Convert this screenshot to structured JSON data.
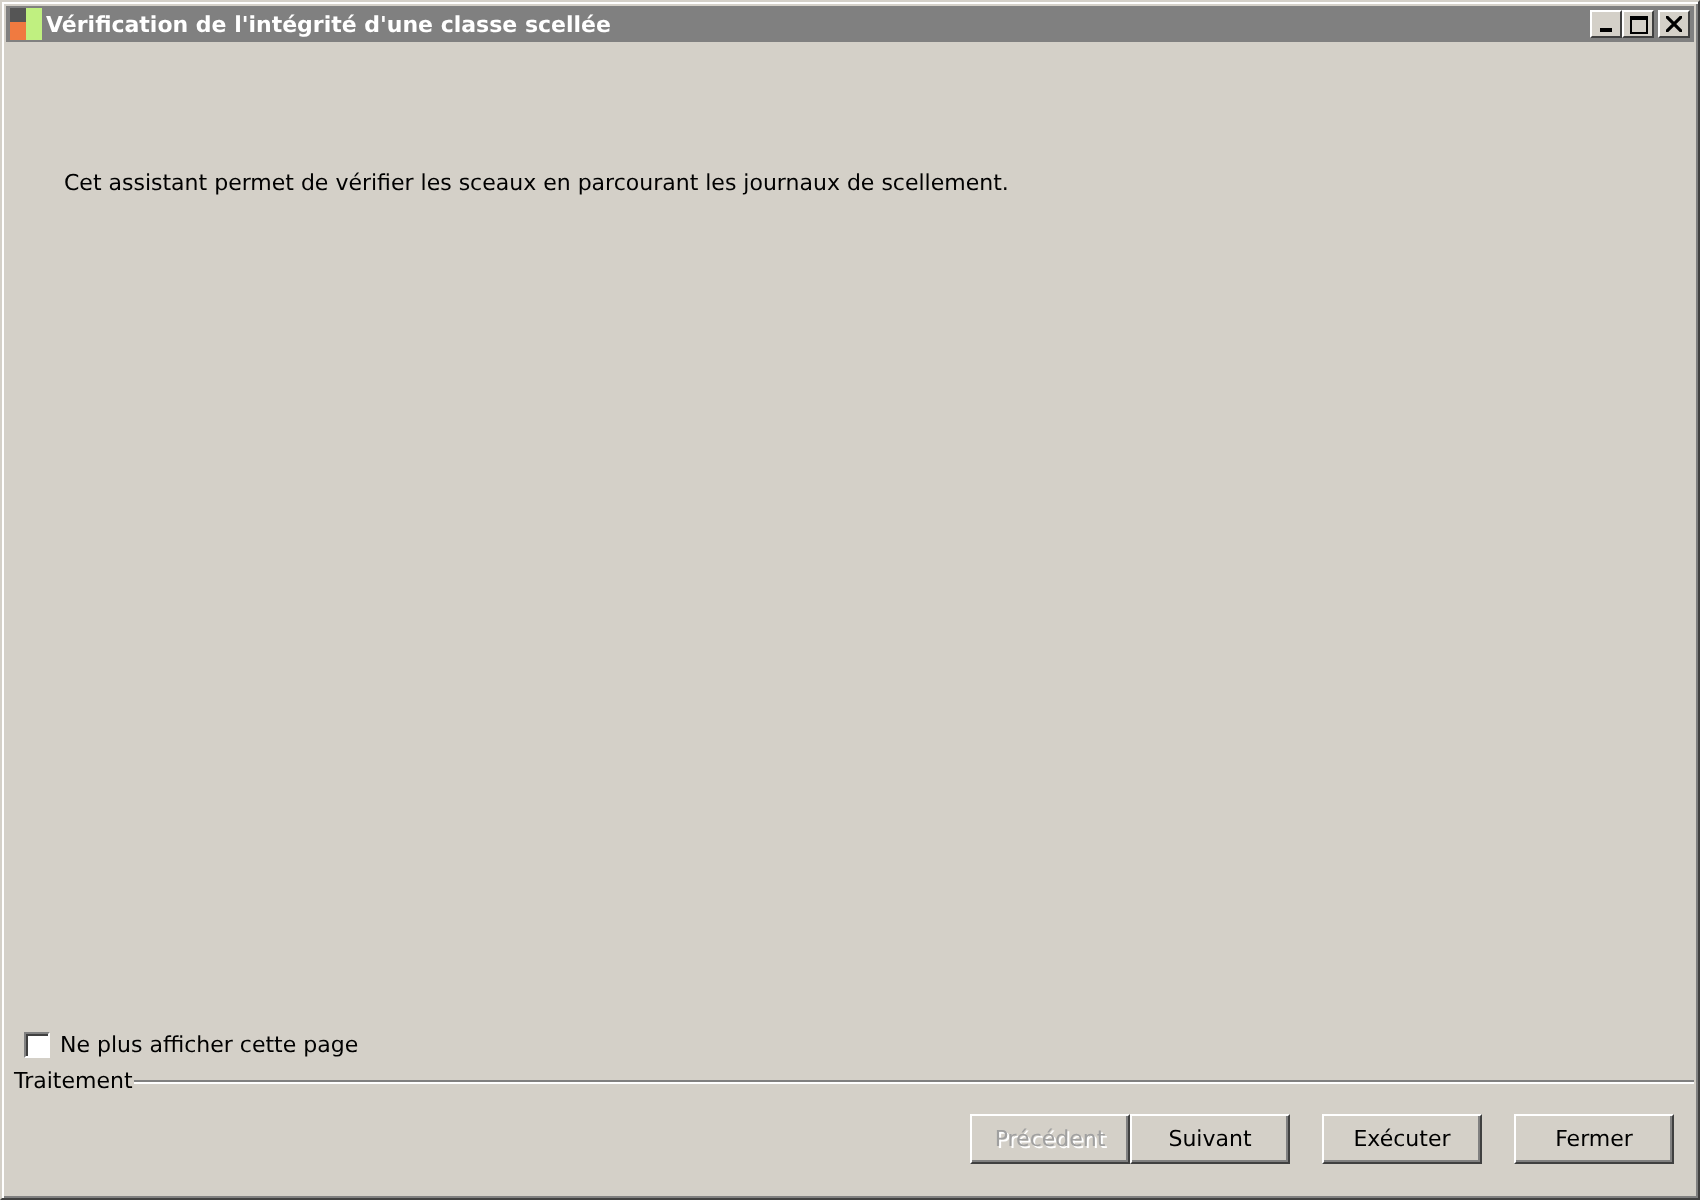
{
  "window": {
    "title": "Vérification de l'intégrité d'une classe scellée"
  },
  "message": "Cet assistant permet de vérifier les sceaux en parcourant les journaux de scellement.",
  "checkbox": {
    "label": "Ne plus afficher cette page",
    "checked": false
  },
  "group_label": "Traitement",
  "buttons": [
    {
      "label": "Précédent",
      "disabled": true
    },
    {
      "label": "Suivant",
      "disabled": false
    },
    {
      "label": "Exécuter",
      "disabled": false
    },
    {
      "label": "Fermer",
      "disabled": false
    }
  ]
}
